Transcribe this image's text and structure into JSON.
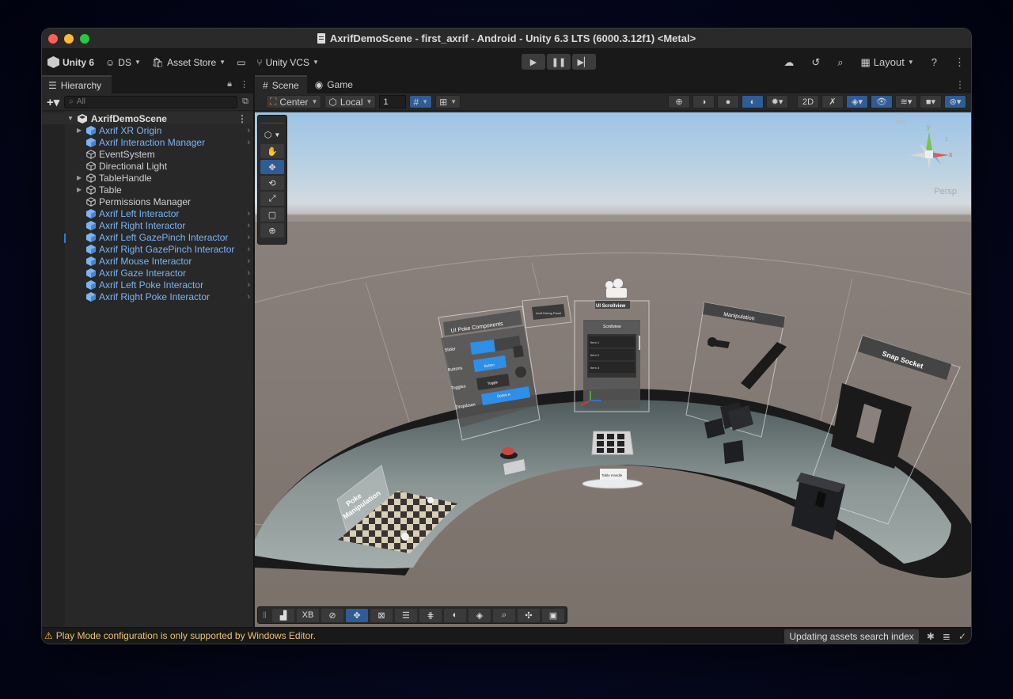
{
  "window": {
    "title": "AxrifDemoScene - first_axrif - Android - Unity 6.3 LTS (6000.3.12f1) <Metal>"
  },
  "toolbar": {
    "unity_label": "Unity 6",
    "account_label": "DS",
    "asset_store_label": "Asset Store",
    "vcs_label": "Unity VCS",
    "layout_label": "Layout"
  },
  "hierarchy": {
    "tab_label": "Hierarchy",
    "search_placeholder": "All",
    "scene_name": "AxrifDemoScene",
    "items": [
      {
        "label": "Axrif XR Origin",
        "prefab": true,
        "expandable": true,
        "chevron": true
      },
      {
        "label": "Axrif Interaction Manager",
        "prefab": true,
        "expandable": false,
        "chevron": true
      },
      {
        "label": "EventSystem",
        "prefab": false,
        "expandable": false,
        "chevron": false
      },
      {
        "label": "Directional Light",
        "prefab": false,
        "expandable": false,
        "chevron": false
      },
      {
        "label": "TableHandle",
        "prefab": false,
        "expandable": true,
        "chevron": false
      },
      {
        "label": "Table",
        "prefab": false,
        "expandable": true,
        "chevron": false
      },
      {
        "label": "Permissions Manager",
        "prefab": false,
        "expandable": false,
        "chevron": false
      },
      {
        "label": "Axrif Left Interactor",
        "prefab": true,
        "expandable": false,
        "chevron": true
      },
      {
        "label": "Axrif Right Interactor",
        "prefab": true,
        "expandable": false,
        "chevron": true
      },
      {
        "label": "Axrif Left GazePinch Interactor",
        "prefab": true,
        "expandable": false,
        "chevron": true
      },
      {
        "label": "Axrif Right GazePinch Interactor",
        "prefab": true,
        "expandable": false,
        "chevron": true
      },
      {
        "label": "Axrif Mouse Interactor",
        "prefab": true,
        "expandable": false,
        "chevron": true
      },
      {
        "label": "Axrif Gaze Interactor",
        "prefab": true,
        "expandable": false,
        "chevron": true
      },
      {
        "label": "Axrif Left Poke Interactor",
        "prefab": true,
        "expandable": false,
        "chevron": true
      },
      {
        "label": "Axrif Right Poke Interactor",
        "prefab": true,
        "expandable": false,
        "chevron": true
      }
    ]
  },
  "scene_view": {
    "tabs": [
      "Scene",
      "Game"
    ],
    "pivot_mode": "Center",
    "pivot_rotation": "Local",
    "grid_snap_value": "1",
    "camera_mode": "Persp",
    "bottom_tools_xb_label": "XB",
    "world_labels": {
      "poke_components": "UI Poke Components",
      "slider": "Slider",
      "buttons": "Buttons",
      "toggles": "Toggles",
      "dropdown": "Dropdown",
      "button": "Button",
      "toggle": "Toggle",
      "option_a": "Option A",
      "debug_panel": "Axrif Debug Panel",
      "scrollview_title": "UI Scrollview",
      "scrollview": "Scrollview",
      "item1": "Item 1",
      "item2": "Item 2",
      "item3": "Item 3",
      "manipulation": "Manipulation",
      "snap_socket": "Snap Socket",
      "poke": "Poke",
      "poke_manipulation": "Manipulation",
      "table_handle": "Table Handle"
    }
  },
  "status": {
    "warning": "Play Mode configuration is only supported by Windows Editor.",
    "progress_label": "Updating assets search index"
  },
  "colors": {
    "accent_blue": "#2f5c95",
    "prefab_blue": "#7ab4f5",
    "warning_yellow": "#e9c46a"
  }
}
